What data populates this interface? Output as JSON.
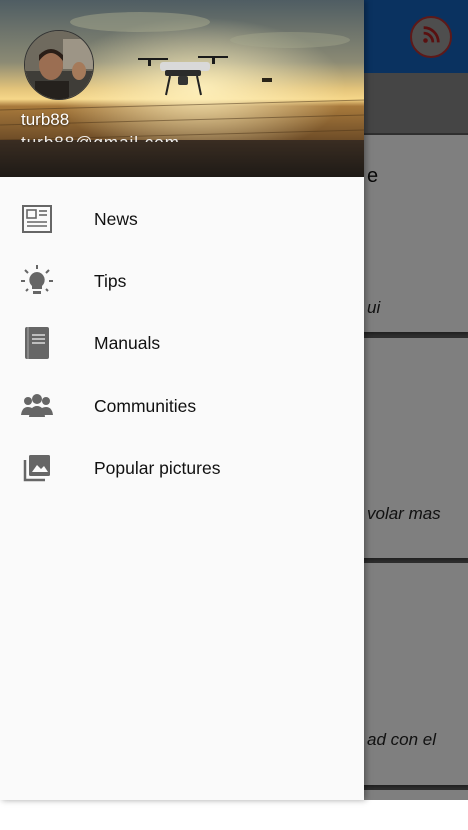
{
  "drawer": {
    "username": "turb88",
    "email": "turb88@gmail.com",
    "items": [
      {
        "label": "News",
        "icon": "newspaper-icon"
      },
      {
        "label": "Tips",
        "icon": "lightbulb-icon"
      },
      {
        "label": "Manuals",
        "icon": "book-icon"
      },
      {
        "label": "Communities",
        "icon": "group-icon"
      },
      {
        "label": "Popular pictures",
        "icon": "photo-library-icon"
      }
    ]
  },
  "background": {
    "rss_icon": "rss-icon",
    "cards": [
      {
        "title_fragment": "e",
        "text_fragment": "ui"
      },
      {
        "text_fragment": "volar mas"
      },
      {
        "text_fragment": "ad con el"
      }
    ]
  },
  "colors": {
    "app_bar": "#1565c0",
    "drawer_bg": "#fafafa",
    "icon_gray": "#666666",
    "rss_red": "#b32020"
  }
}
